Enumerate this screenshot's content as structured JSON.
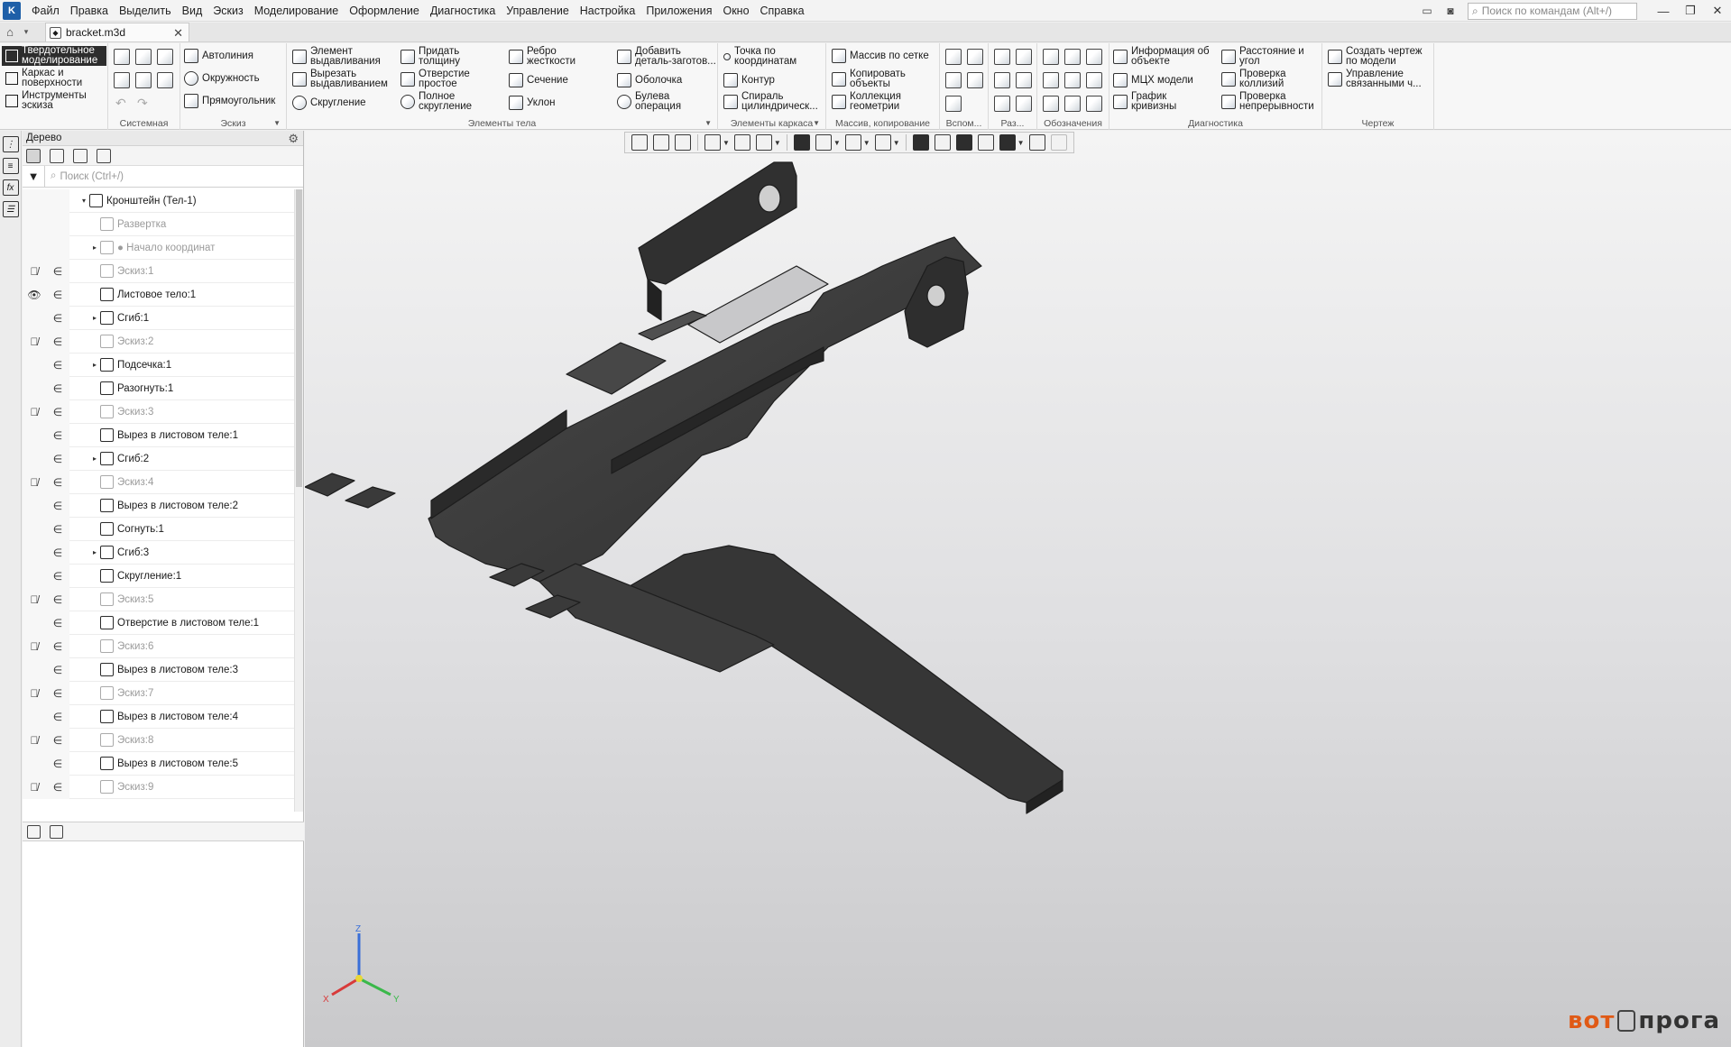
{
  "menubar": {
    "items": [
      "Файл",
      "Правка",
      "Выделить",
      "Вид",
      "Эскиз",
      "Моделирование",
      "Оформление",
      "Диагностика",
      "Управление",
      "Настройка",
      "Приложения",
      "Окно",
      "Справка"
    ],
    "command_search_placeholder": "Поиск по командам (Alt+/)"
  },
  "tabs": {
    "document": "bracket.m3d"
  },
  "ribbon": {
    "modes": [
      "Твердотельное\nмоделирование",
      "Каркас и\nповерхности",
      "Инструменты\nэскиза"
    ],
    "groups": {
      "system": {
        "label": "Системная"
      },
      "sketch": {
        "label": "Эскиз",
        "buttons": [
          "Автолиния",
          "Окружность",
          "Прямоугольник"
        ]
      },
      "body": {
        "label": "Элементы тела",
        "buttons": [
          "Элемент\nвыдавливания",
          "Вырезать\nвыдавливанием",
          "Скругление",
          "Придать\nтолщину",
          "Отверстие\nпростое",
          "Полное\nскругление",
          "Ребро\nжесткости",
          "Сечение",
          "Уклон",
          "Добавить\nдеталь-заготов...",
          "Оболочка",
          "Булева\nоперация"
        ]
      },
      "frame": {
        "label": "Элементы каркаса",
        "buttons": [
          "Точка по\nкоординатам",
          "Контур",
          "Спираль\nцилиндрическ..."
        ]
      },
      "arrays": {
        "label": "Массив, копирование",
        "buttons": [
          "Массив по сетке",
          "Копировать\nобъекты",
          "Коллекция\nгеометрии"
        ]
      },
      "aux": {
        "label": "Вспом..."
      },
      "sizes": {
        "label": "Раз..."
      },
      "marks": {
        "label": "Обозначения"
      },
      "diag": {
        "label": "Диагностика",
        "buttons": [
          "Информация об\nобъекте",
          "МЦХ модели",
          "График\nкривизны",
          "Расстояние и\nугол",
          "Проверка\nколлизий",
          "Проверка\nнепрерывности"
        ]
      },
      "drawing": {
        "label": "Чертеж",
        "buttons": [
          "Создать чертеж\nпо модели",
          "Управление\nсвязанными ч..."
        ]
      }
    }
  },
  "tree": {
    "title": "Дерево",
    "search_placeholder": "Поиск (Ctrl+/)",
    "rows": [
      {
        "label": "Кронштейн (Тел-1)",
        "indent": 0,
        "expander": "▾",
        "vis": "",
        "rel": "",
        "dim": false
      },
      {
        "label": "Развертка",
        "indent": 1,
        "expander": "",
        "vis": "",
        "rel": "",
        "dim": true
      },
      {
        "label": "● Начало координат",
        "indent": 1,
        "expander": "▸",
        "vis": "",
        "rel": "",
        "dim": true
      },
      {
        "label": "Эскиз:1",
        "indent": 1,
        "expander": "",
        "vis": "👁̸",
        "rel": "∈",
        "dim": true
      },
      {
        "label": "Листовое тело:1",
        "indent": 1,
        "expander": "",
        "vis": "👁",
        "rel": "∈",
        "dim": false
      },
      {
        "label": "Сгиб:1",
        "indent": 1,
        "expander": "▸",
        "vis": "",
        "rel": "∈",
        "dim": false
      },
      {
        "label": "Эскиз:2",
        "indent": 1,
        "expander": "",
        "vis": "👁̸",
        "rel": "∈",
        "dim": true
      },
      {
        "label": "Подсечка:1",
        "indent": 1,
        "expander": "▸",
        "vis": "",
        "rel": "∈",
        "dim": false
      },
      {
        "label": "Разогнуть:1",
        "indent": 1,
        "expander": "",
        "vis": "",
        "rel": "∈",
        "dim": false
      },
      {
        "label": "Эскиз:3",
        "indent": 1,
        "expander": "",
        "vis": "👁̸",
        "rel": "∈",
        "dim": true
      },
      {
        "label": "Вырез в листовом теле:1",
        "indent": 1,
        "expander": "",
        "vis": "",
        "rel": "∈",
        "dim": false
      },
      {
        "label": "Сгиб:2",
        "indent": 1,
        "expander": "▸",
        "vis": "",
        "rel": "∈",
        "dim": false
      },
      {
        "label": "Эскиз:4",
        "indent": 1,
        "expander": "",
        "vis": "👁̸",
        "rel": "∈",
        "dim": true
      },
      {
        "label": "Вырез в листовом теле:2",
        "indent": 1,
        "expander": "",
        "vis": "",
        "rel": "∈",
        "dim": false
      },
      {
        "label": "Согнуть:1",
        "indent": 1,
        "expander": "",
        "vis": "",
        "rel": "∈",
        "dim": false
      },
      {
        "label": "Сгиб:3",
        "indent": 1,
        "expander": "▸",
        "vis": "",
        "rel": "∈",
        "dim": false
      },
      {
        "label": "Скругление:1",
        "indent": 1,
        "expander": "",
        "vis": "",
        "rel": "∈",
        "dim": false
      },
      {
        "label": "Эскиз:5",
        "indent": 1,
        "expander": "",
        "vis": "👁̸",
        "rel": "∈",
        "dim": true
      },
      {
        "label": "Отверстие в листовом теле:1",
        "indent": 1,
        "expander": "",
        "vis": "",
        "rel": "∈",
        "dim": false
      },
      {
        "label": "Эскиз:6",
        "indent": 1,
        "expander": "",
        "vis": "👁̸",
        "rel": "∈",
        "dim": true
      },
      {
        "label": "Вырез в листовом теле:3",
        "indent": 1,
        "expander": "",
        "vis": "",
        "rel": "∈",
        "dim": false
      },
      {
        "label": "Эскиз:7",
        "indent": 1,
        "expander": "",
        "vis": "👁̸",
        "rel": "∈",
        "dim": true
      },
      {
        "label": "Вырез в листовом теле:4",
        "indent": 1,
        "expander": "",
        "vis": "",
        "rel": "∈",
        "dim": false
      },
      {
        "label": "Эскиз:8",
        "indent": 1,
        "expander": "",
        "vis": "👁̸",
        "rel": "∈",
        "dim": true
      },
      {
        "label": "Вырез в листовом теле:5",
        "indent": 1,
        "expander": "",
        "vis": "",
        "rel": "∈",
        "dim": false
      },
      {
        "label": "Эскиз:9",
        "indent": 1,
        "expander": "",
        "vis": "👁̸",
        "rel": "∈",
        "dim": true
      }
    ]
  },
  "viewport": {
    "axes": {
      "x": "X",
      "y": "Y",
      "z": "Z"
    },
    "watermark": {
      "left": "вот",
      "right": "прога"
    },
    "model_color": "#3b3b3b"
  },
  "colors": {
    "accent": "#1e5fa8",
    "active_mode_bg": "#2d2d2d",
    "watermark": "#e05a16"
  }
}
